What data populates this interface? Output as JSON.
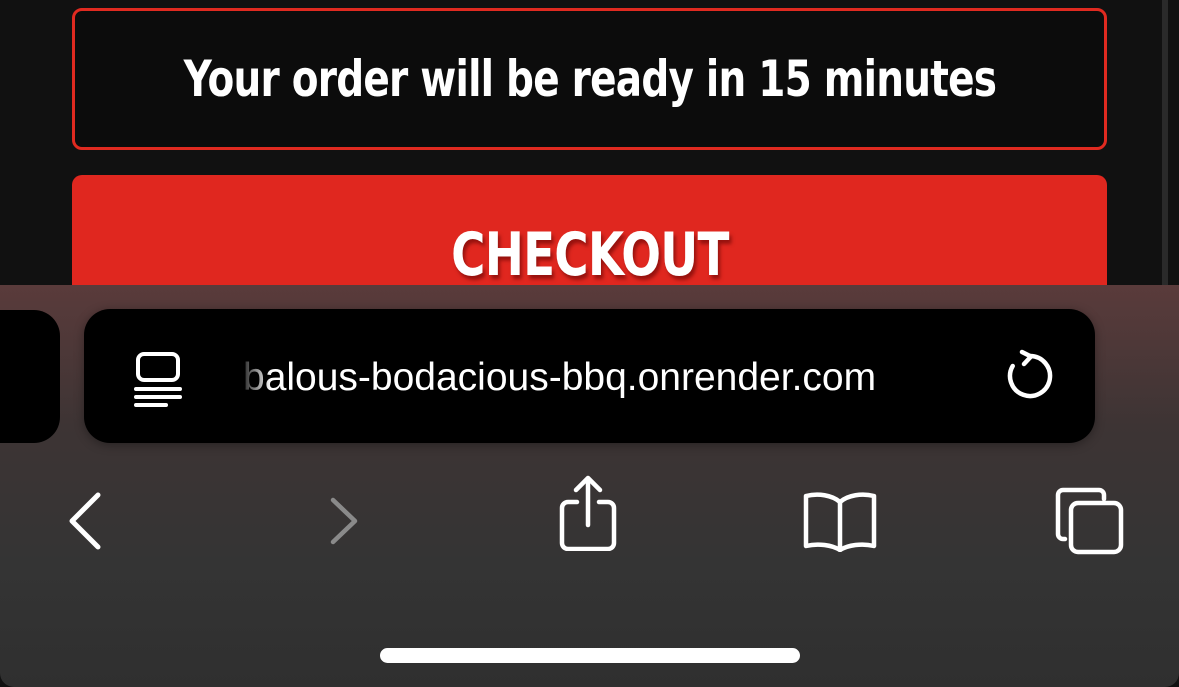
{
  "page": {
    "eta_banner_text": "Your order will be ready in 15 minutes",
    "checkout_label": "CHECKOUT"
  },
  "browser": {
    "url_text": "balous-bodacious-bbq.onrender.com",
    "toolbar": {
      "back_icon": "chevron-left",
      "forward_icon": "chevron-right",
      "share_icon": "share",
      "bookmarks_icon": "book",
      "tabs_icon": "tabs"
    }
  },
  "colors": {
    "accent_red": "#e0271f",
    "background": "#111111",
    "chrome": "#343434"
  }
}
